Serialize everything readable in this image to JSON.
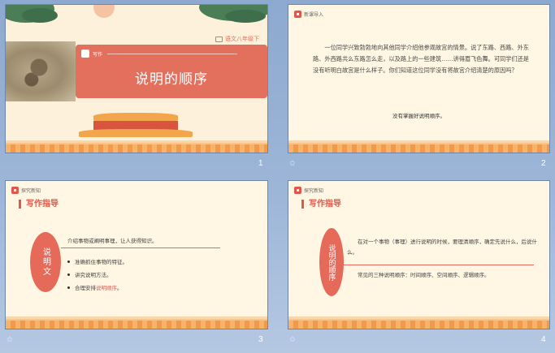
{
  "slides": [
    {
      "number": "1",
      "grade_label": "语文八年级下",
      "sub_label": "写作",
      "title": "说明的顺序"
    },
    {
      "number": "2",
      "tag": "新课导入",
      "paragraph": "一位同学兴致勃勃地向其他同学介绍他参观故宫的情景。说了东路、西路、外东路、外西路共么东路怎么走，以及路上的一些建筑……讲得眉飞色舞。可同学们还是没有听明白故宫是什么样子。你们知道这位同学没有将故宫介绍清楚的原因吗？",
      "quote": "没有掌握好说明顺序。"
    },
    {
      "number": "3",
      "tag": "探究新知",
      "section_title": "写作指导",
      "oval_text": "说明文",
      "intro": "介绍事物或阐明事理，让人获得知识。",
      "bullets": [
        "准确抓住事物的特征。",
        "讲究说明方法。"
      ],
      "bullet3_prefix": "合理安排",
      "bullet3_highlight": "说明顺序",
      "bullet3_suffix": "。"
    },
    {
      "number": "4",
      "tag": "探究新知",
      "section_title": "写作指导",
      "oval_text": "说明的顺序",
      "para1": "在对一个事物（事理）进行说明的时候，要理清顺序，确定先说什么，后说什么。",
      "para2": "常见的三种说明顺序：时间顺序、空间顺序、逻辑顺序。"
    }
  ],
  "star_glyph": "✩"
}
